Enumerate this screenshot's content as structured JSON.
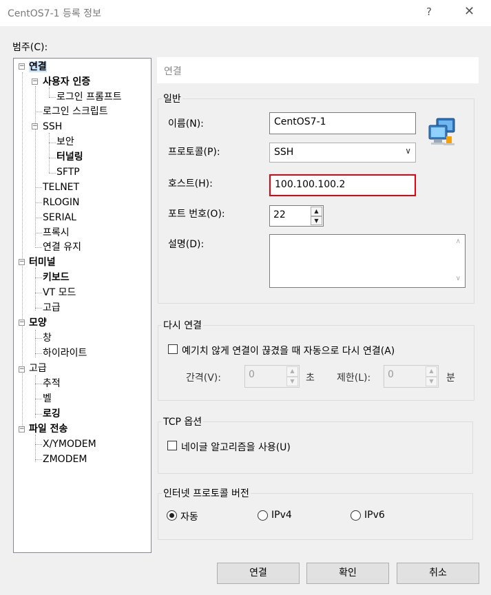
{
  "window": {
    "title": "CentOS7-1 등록 정보",
    "help": "?",
    "close": "✕"
  },
  "category_label": "범주(C):",
  "tree": [
    {
      "label": "연결",
      "bold": true,
      "selected": true
    },
    {
      "label": "사용자 인증",
      "bold": true
    },
    {
      "label": "로그인 프롬프트"
    },
    {
      "label": "로그인 스크립트"
    },
    {
      "label": "SSH"
    },
    {
      "label": "보안"
    },
    {
      "label": "터널링",
      "bold": true
    },
    {
      "label": "SFTP"
    },
    {
      "label": "TELNET"
    },
    {
      "label": "RLOGIN"
    },
    {
      "label": "SERIAL"
    },
    {
      "label": "프록시"
    },
    {
      "label": "연결 유지"
    },
    {
      "label": "터미널",
      "bold": true
    },
    {
      "label": "키보드",
      "bold": true
    },
    {
      "label": "VT 모드"
    },
    {
      "label": "고급"
    },
    {
      "label": "모양",
      "bold": true
    },
    {
      "label": "창"
    },
    {
      "label": "하이라이트"
    },
    {
      "label": "고급"
    },
    {
      "label": "추적"
    },
    {
      "label": "벨"
    },
    {
      "label": "로깅",
      "bold": true
    },
    {
      "label": "파일 전송",
      "bold": true
    },
    {
      "label": "X/YMODEM"
    },
    {
      "label": "ZMODEM"
    }
  ],
  "header": "연결",
  "general": {
    "title": "일반",
    "name_label": "이름(N):",
    "name_value": "CentOS7-1",
    "protocol_label": "프로토콜(P):",
    "protocol_value": "SSH",
    "host_label": "호스트(H):",
    "host_value": "100.100.100.2",
    "port_label": "포트 번호(O):",
    "port_value": "22",
    "desc_label": "설명(D):",
    "desc_value": ""
  },
  "reconnect": {
    "title": "다시 연결",
    "checkbox_label": "예기치 않게 연결이 끊겼을 때 자동으로 다시 연결(A)",
    "checked": false,
    "interval_label": "간격(V):",
    "interval_value": "0",
    "interval_unit": "초",
    "limit_label": "제한(L):",
    "limit_value": "0",
    "limit_unit": "분"
  },
  "tcp": {
    "title": "TCP 옵션",
    "nagle_label": "네이글 알고리즘을 사용(U)",
    "checked": false
  },
  "ip_version": {
    "title": "인터넷 프로토콜 버전",
    "options": [
      "자동",
      "IPv4",
      "IPv6"
    ],
    "selected": "자동"
  },
  "buttons": {
    "connect": "연결",
    "ok": "확인",
    "cancel": "취소"
  },
  "icons": {
    "network": "network-computers-icon"
  }
}
